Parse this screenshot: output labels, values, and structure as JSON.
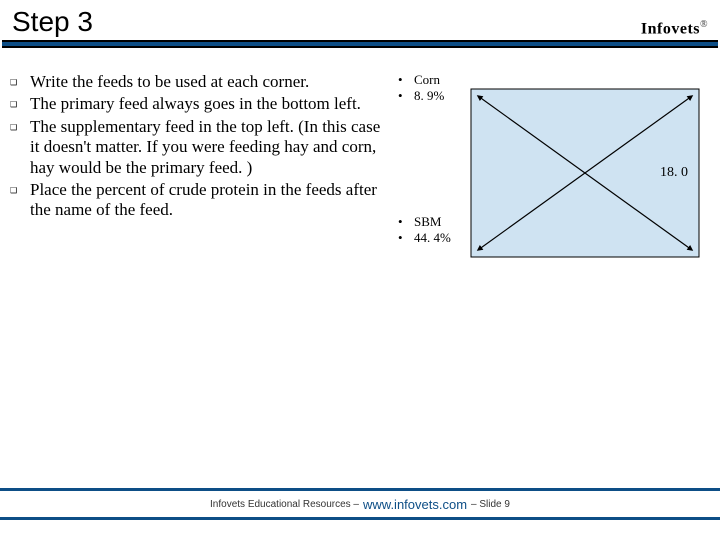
{
  "header": {
    "title": "Step 3",
    "brand": "Infovets",
    "brand_mark": "®"
  },
  "bullets": [
    "Write the feeds to be used at each corner.",
    "The primary feed always goes in the bottom left.",
    "The supplementary feed in the top left. (In this case it doesn't matter. If you were feeding hay and corn, hay would be the primary feed. )",
    "Place the percent of crude protein in the feeds after the name of the feed."
  ],
  "diagram": {
    "top_label_name": "Corn",
    "top_label_value": "8. 9%",
    "bottom_label_name": "SBM",
    "bottom_label_value": "44. 4%",
    "center_value": "18. 0"
  },
  "footer": {
    "prefix": "Infovets Educational Resources –",
    "url": "www.infovets.com",
    "suffix": "– Slide 9"
  },
  "chart_data": {
    "type": "table",
    "title": "Pearson square feed corners",
    "rows": [
      {
        "corner": "top-left",
        "feed": "Corn",
        "crude_protein_pct": 8.9
      },
      {
        "corner": "bottom-left",
        "feed": "SBM",
        "crude_protein_pct": 44.4
      }
    ],
    "target_crude_protein_pct": 18.0
  }
}
